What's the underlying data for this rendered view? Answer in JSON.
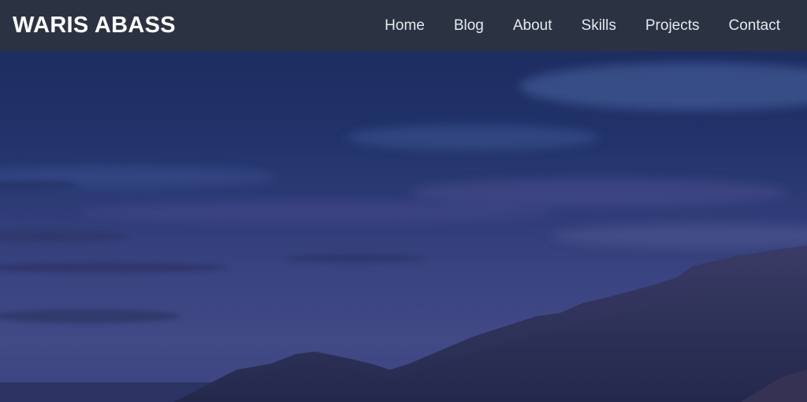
{
  "header": {
    "brand": "WARIS ABASS",
    "nav": [
      {
        "label": "Home"
      },
      {
        "label": "Blog"
      },
      {
        "label": "About"
      },
      {
        "label": "Skills"
      },
      {
        "label": "Projects"
      },
      {
        "label": "Contact"
      }
    ]
  },
  "colors": {
    "navbar_bg": "#2c3442",
    "sky_top": "#1b2d63",
    "sky_mid": "#2d3a76",
    "sky_low": "#3d4683",
    "mountain": "#2a2f55",
    "brand_text": "#ffffff",
    "nav_text": "#e6e8ec"
  }
}
